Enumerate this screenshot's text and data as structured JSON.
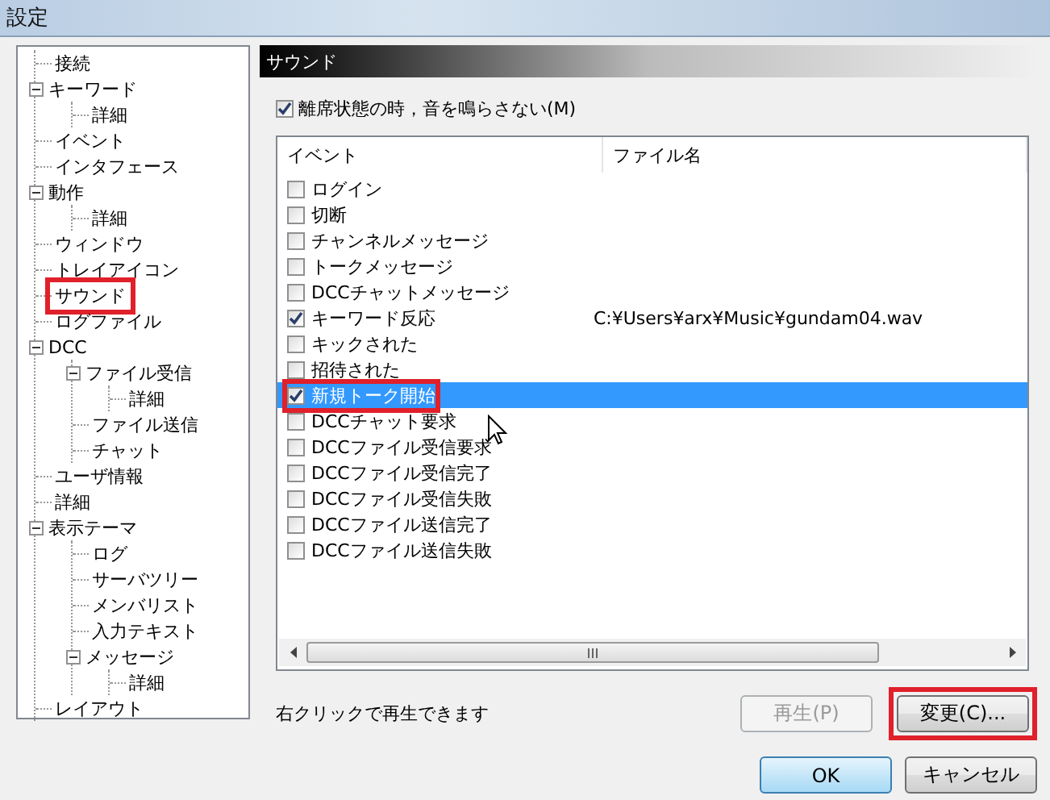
{
  "window": {
    "title": "設定"
  },
  "tree": [
    {
      "label": "接続",
      "highlighted": false
    },
    {
      "label": "キーワード",
      "highlighted": false,
      "expanded": true,
      "children": [
        {
          "label": "詳細",
          "highlighted": false
        }
      ]
    },
    {
      "label": "イベント",
      "highlighted": false
    },
    {
      "label": "インタフェース",
      "highlighted": false
    },
    {
      "label": "動作",
      "highlighted": false,
      "expanded": true,
      "children": [
        {
          "label": "詳細",
          "highlighted": false
        }
      ]
    },
    {
      "label": "ウィンドウ",
      "highlighted": false
    },
    {
      "label": "トレイアイコン",
      "highlighted": false
    },
    {
      "label": "サウンド",
      "highlighted": true
    },
    {
      "label": "ログファイル",
      "highlighted": false
    },
    {
      "label": "DCC",
      "highlighted": false,
      "expanded": true,
      "children": [
        {
          "label": "ファイル受信",
          "highlighted": false,
          "expanded": true,
          "children": [
            {
              "label": "詳細",
              "highlighted": false
            }
          ]
        },
        {
          "label": "ファイル送信",
          "highlighted": false
        },
        {
          "label": "チャット",
          "highlighted": false
        }
      ]
    },
    {
      "label": "ユーザ情報",
      "highlighted": false
    },
    {
      "label": "詳細",
      "highlighted": false
    },
    {
      "label": "表示テーマ",
      "highlighted": false,
      "expanded": true,
      "children": [
        {
          "label": "ログ",
          "highlighted": false
        },
        {
          "label": "サーバツリー",
          "highlighted": false
        },
        {
          "label": "メンバリスト",
          "highlighted": false
        },
        {
          "label": "入力テキスト",
          "highlighted": false
        },
        {
          "label": "メッセージ",
          "highlighted": false,
          "expanded": true,
          "children": [
            {
              "label": "詳細",
              "highlighted": false
            }
          ]
        }
      ]
    },
    {
      "label": "レイアウト",
      "highlighted": false
    }
  ],
  "panel": {
    "title": "サウンド",
    "mute_option": {
      "label": "離席状態の時，音を鳴らさない(M)",
      "checked": true
    },
    "columns": [
      "イベント",
      "ファイル名"
    ],
    "events": [
      {
        "label": "ログイン",
        "checked": false,
        "selected": false,
        "highlighted": false
      },
      {
        "label": "切断",
        "checked": false,
        "selected": false,
        "highlighted": false
      },
      {
        "label": "チャンネルメッセージ",
        "checked": false,
        "selected": false,
        "highlighted": false
      },
      {
        "label": "トークメッセージ",
        "checked": false,
        "selected": false,
        "highlighted": false
      },
      {
        "label": "DCCチャットメッセージ",
        "checked": false,
        "selected": false,
        "highlighted": false
      },
      {
        "label": "キーワード反応",
        "checked": true,
        "selected": false,
        "highlighted": false,
        "file": "C:¥Users¥arx¥Music¥gundam04.wav"
      },
      {
        "label": "キックされた",
        "checked": false,
        "selected": false,
        "highlighted": false
      },
      {
        "label": "招待された",
        "checked": false,
        "selected": false,
        "highlighted": false
      },
      {
        "label": "新規トーク開始",
        "checked": true,
        "selected": true,
        "highlighted": true
      },
      {
        "label": "DCCチャット要求",
        "checked": false,
        "selected": false,
        "highlighted": false
      },
      {
        "label": "DCCファイル受信要求",
        "checked": false,
        "selected": false,
        "highlighted": false
      },
      {
        "label": "DCCファイル受信完了",
        "checked": false,
        "selected": false,
        "highlighted": false
      },
      {
        "label": "DCCファイル受信失敗",
        "checked": false,
        "selected": false,
        "highlighted": false
      },
      {
        "label": "DCCファイル送信完了",
        "checked": false,
        "selected": false,
        "highlighted": false
      },
      {
        "label": "DCCファイル送信失敗",
        "checked": false,
        "selected": false,
        "highlighted": false
      }
    ],
    "hint": "右クリックで再生できます",
    "buttons": [
      {
        "label": "再生(P)",
        "disabled": true,
        "highlighted": false
      },
      {
        "label": "変更(C)...",
        "disabled": false,
        "highlighted": true
      }
    ]
  },
  "dialog_buttons": [
    {
      "label": "OK",
      "default": true
    },
    {
      "label": "キャンセル",
      "default": false
    }
  ]
}
